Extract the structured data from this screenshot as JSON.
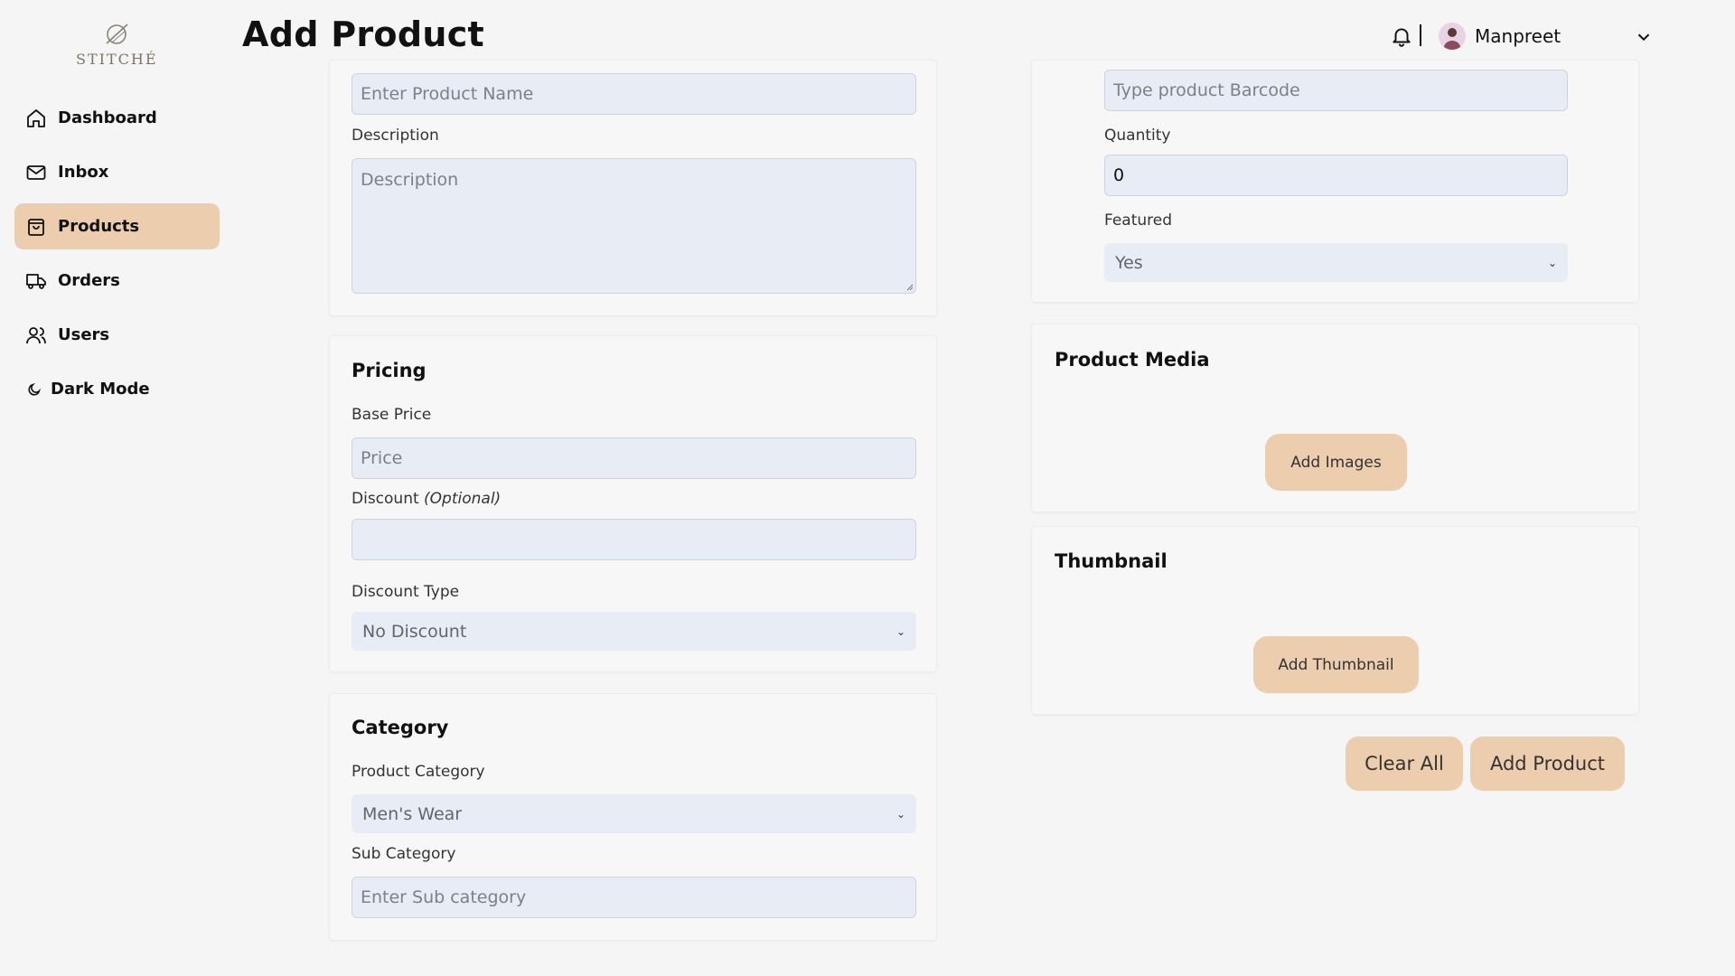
{
  "brand": {
    "name": "STITCHÉ"
  },
  "sidebar": {
    "items": [
      {
        "label": "Dashboard",
        "icon": "home-icon"
      },
      {
        "label": "Inbox",
        "icon": "mail-icon"
      },
      {
        "label": "Products",
        "icon": "shopping-bag-icon",
        "active": true
      },
      {
        "label": "Orders",
        "icon": "truck-icon"
      },
      {
        "label": "Users",
        "icon": "users-icon"
      },
      {
        "label": "Dark Mode",
        "icon": "moon-icon"
      }
    ]
  },
  "header": {
    "title": "Add Product",
    "user_name": "Manpreet"
  },
  "general": {
    "product_name_placeholder": "Enter Product Name",
    "description_label": "Description",
    "description_placeholder": "Description"
  },
  "pricing": {
    "title": "Pricing",
    "base_price_label": "Base Price",
    "price_placeholder": "Price",
    "discount_label": "Discount",
    "discount_optional": "(Optional)",
    "discount_value": "",
    "discount_type_label": "Discount Type",
    "discount_type_value": "No Discount"
  },
  "category": {
    "title": "Category",
    "product_category_label": "Product Category",
    "product_category_value": "Men's Wear",
    "sub_category_label": "Sub Category",
    "sub_category_placeholder": "Enter Sub category"
  },
  "inventory": {
    "barcode_placeholder": "Type product Barcode",
    "quantity_label": "Quantity",
    "quantity_value": "0",
    "featured_label": "Featured",
    "featured_value": "Yes"
  },
  "media": {
    "title": "Product Media",
    "add_images_label": "Add Images"
  },
  "thumbnail": {
    "title": "Thumbnail",
    "add_thumbnail_label": "Add Thumbnail"
  },
  "actions": {
    "clear_all_label": "Clear All",
    "add_product_label": "Add Product"
  },
  "colors": {
    "accent": "#ecceaf",
    "input_bg": "#e8edf5",
    "background": "#f5f5f5"
  }
}
